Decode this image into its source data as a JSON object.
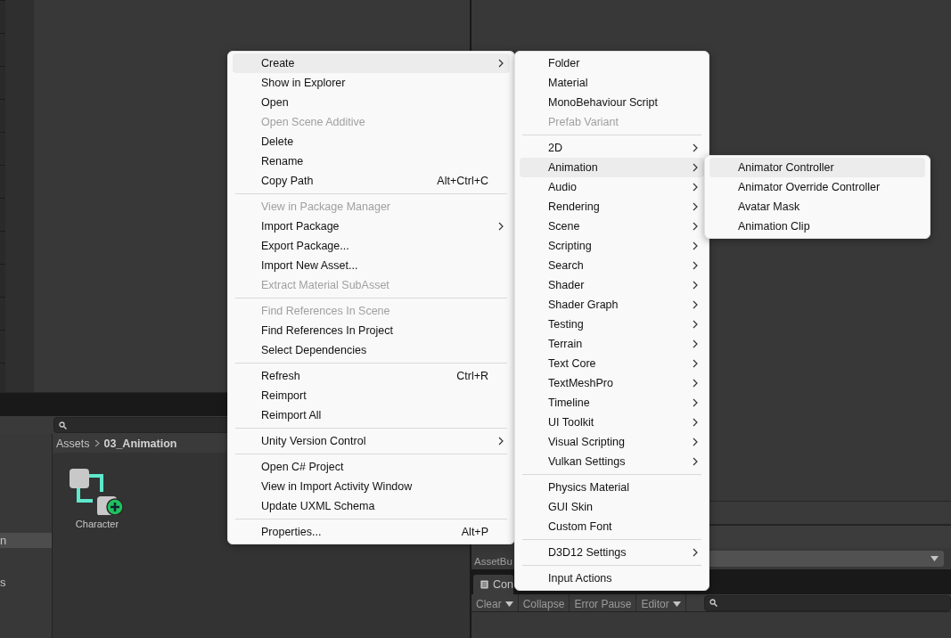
{
  "project": {
    "tree_items": [
      {
        "label": "n",
        "selected": true
      },
      {
        "label": "s",
        "selected": false
      }
    ],
    "breadcrumb": [
      "Assets",
      "03_Animation"
    ],
    "assets": [
      {
        "name": "Character"
      }
    ]
  },
  "inspector": {
    "field_label": "AssetBu"
  },
  "console": {
    "tab": "Con",
    "toolbar": [
      {
        "label": "Clear",
        "dropdown": true
      },
      {
        "label": "Collapse",
        "dropdown": false
      },
      {
        "label": "Error Pause",
        "dropdown": false
      },
      {
        "label": "Editor",
        "dropdown": true
      }
    ]
  },
  "menus": [
    {
      "items": [
        {
          "kind": "item",
          "label": "Create",
          "submenu": true,
          "disabled": false,
          "selected": true
        },
        {
          "kind": "item",
          "label": "Show in Explorer",
          "submenu": false,
          "disabled": false,
          "selected": false
        },
        {
          "kind": "item",
          "label": "Open",
          "submenu": false,
          "disabled": false,
          "selected": false
        },
        {
          "kind": "item",
          "label": "Open Scene Additive",
          "submenu": false,
          "disabled": true,
          "selected": false
        },
        {
          "kind": "item",
          "label": "Delete",
          "submenu": false,
          "disabled": false,
          "selected": false
        },
        {
          "kind": "item",
          "label": "Rename",
          "submenu": false,
          "disabled": false,
          "selected": false
        },
        {
          "kind": "item",
          "label": "Copy Path",
          "shortcut": "Alt+Ctrl+C",
          "submenu": false,
          "disabled": false,
          "selected": false
        },
        {
          "kind": "separator"
        },
        {
          "kind": "item",
          "label": "View in Package Manager",
          "submenu": false,
          "disabled": true,
          "selected": false
        },
        {
          "kind": "item",
          "label": "Import Package",
          "submenu": true,
          "disabled": false,
          "selected": false
        },
        {
          "kind": "item",
          "label": "Export Package...",
          "submenu": false,
          "disabled": false,
          "selected": false
        },
        {
          "kind": "item",
          "label": "Import New Asset...",
          "submenu": false,
          "disabled": false,
          "selected": false
        },
        {
          "kind": "item",
          "label": "Extract Material SubAsset",
          "submenu": false,
          "disabled": true,
          "selected": false
        },
        {
          "kind": "separator"
        },
        {
          "kind": "item",
          "label": "Find References In Scene",
          "submenu": false,
          "disabled": true,
          "selected": false
        },
        {
          "kind": "item",
          "label": "Find References In Project",
          "submenu": false,
          "disabled": false,
          "selected": false
        },
        {
          "kind": "item",
          "label": "Select Dependencies",
          "submenu": false,
          "disabled": false,
          "selected": false
        },
        {
          "kind": "separator"
        },
        {
          "kind": "item",
          "label": "Refresh",
          "shortcut": "Ctrl+R",
          "submenu": false,
          "disabled": false,
          "selected": false
        },
        {
          "kind": "item",
          "label": "Reimport",
          "submenu": false,
          "disabled": false,
          "selected": false
        },
        {
          "kind": "item",
          "label": "Reimport All",
          "submenu": false,
          "disabled": false,
          "selected": false
        },
        {
          "kind": "separator"
        },
        {
          "kind": "item",
          "label": "Unity Version Control",
          "submenu": true,
          "disabled": false,
          "selected": false
        },
        {
          "kind": "separator"
        },
        {
          "kind": "item",
          "label": "Open C# Project",
          "submenu": false,
          "disabled": false,
          "selected": false
        },
        {
          "kind": "item",
          "label": "View in Import Activity Window",
          "submenu": false,
          "disabled": false,
          "selected": false
        },
        {
          "kind": "item",
          "label": "Update UXML Schema",
          "submenu": false,
          "disabled": false,
          "selected": false
        },
        {
          "kind": "separator"
        },
        {
          "kind": "item",
          "label": "Properties...",
          "shortcut": "Alt+P",
          "submenu": false,
          "disabled": false,
          "selected": false
        }
      ]
    },
    {
      "items": [
        {
          "kind": "item",
          "label": "Folder",
          "submenu": false,
          "disabled": false,
          "selected": false
        },
        {
          "kind": "item",
          "label": "Material",
          "submenu": false,
          "disabled": false,
          "selected": false
        },
        {
          "kind": "item",
          "label": "MonoBehaviour Script",
          "submenu": false,
          "disabled": false,
          "selected": false
        },
        {
          "kind": "item",
          "label": "Prefab Variant",
          "submenu": false,
          "disabled": true,
          "selected": false
        },
        {
          "kind": "separator"
        },
        {
          "kind": "item",
          "label": "2D",
          "submenu": true,
          "disabled": false,
          "selected": false
        },
        {
          "kind": "item",
          "label": "Animation",
          "submenu": true,
          "disabled": false,
          "selected": true
        },
        {
          "kind": "item",
          "label": "Audio",
          "submenu": true,
          "disabled": false,
          "selected": false
        },
        {
          "kind": "item",
          "label": "Rendering",
          "submenu": true,
          "disabled": false,
          "selected": false
        },
        {
          "kind": "item",
          "label": "Scene",
          "submenu": true,
          "disabled": false,
          "selected": false
        },
        {
          "kind": "item",
          "label": "Scripting",
          "submenu": true,
          "disabled": false,
          "selected": false
        },
        {
          "kind": "item",
          "label": "Search",
          "submenu": true,
          "disabled": false,
          "selected": false
        },
        {
          "kind": "item",
          "label": "Shader",
          "submenu": true,
          "disabled": false,
          "selected": false
        },
        {
          "kind": "item",
          "label": "Shader Graph",
          "submenu": true,
          "disabled": false,
          "selected": false
        },
        {
          "kind": "item",
          "label": "Testing",
          "submenu": true,
          "disabled": false,
          "selected": false
        },
        {
          "kind": "item",
          "label": "Terrain",
          "submenu": true,
          "disabled": false,
          "selected": false
        },
        {
          "kind": "item",
          "label": "Text Core",
          "submenu": true,
          "disabled": false,
          "selected": false
        },
        {
          "kind": "item",
          "label": "TextMeshPro",
          "submenu": true,
          "disabled": false,
          "selected": false
        },
        {
          "kind": "item",
          "label": "Timeline",
          "submenu": true,
          "disabled": false,
          "selected": false
        },
        {
          "kind": "item",
          "label": "UI Toolkit",
          "submenu": true,
          "disabled": false,
          "selected": false
        },
        {
          "kind": "item",
          "label": "Visual Scripting",
          "submenu": true,
          "disabled": false,
          "selected": false
        },
        {
          "kind": "item",
          "label": "Vulkan Settings",
          "submenu": true,
          "disabled": false,
          "selected": false
        },
        {
          "kind": "separator"
        },
        {
          "kind": "item",
          "label": "Physics Material",
          "submenu": false,
          "disabled": false,
          "selected": false
        },
        {
          "kind": "item",
          "label": "GUI Skin",
          "submenu": false,
          "disabled": false,
          "selected": false
        },
        {
          "kind": "item",
          "label": "Custom Font",
          "submenu": false,
          "disabled": false,
          "selected": false
        },
        {
          "kind": "separator"
        },
        {
          "kind": "item",
          "label": "D3D12 Settings",
          "submenu": true,
          "disabled": false,
          "selected": false
        },
        {
          "kind": "separator"
        },
        {
          "kind": "item",
          "label": "Input Actions",
          "submenu": false,
          "disabled": false,
          "selected": false
        }
      ]
    },
    {
      "items": [
        {
          "kind": "item",
          "label": "Animator Controller",
          "submenu": false,
          "disabled": false,
          "selected": true
        },
        {
          "kind": "item",
          "label": "Animator Override Controller",
          "submenu": false,
          "disabled": false,
          "selected": false
        },
        {
          "kind": "item",
          "label": "Avatar Mask",
          "submenu": false,
          "disabled": false,
          "selected": false
        },
        {
          "kind": "item",
          "label": "Animation Clip",
          "submenu": false,
          "disabled": false,
          "selected": false
        }
      ]
    }
  ]
}
